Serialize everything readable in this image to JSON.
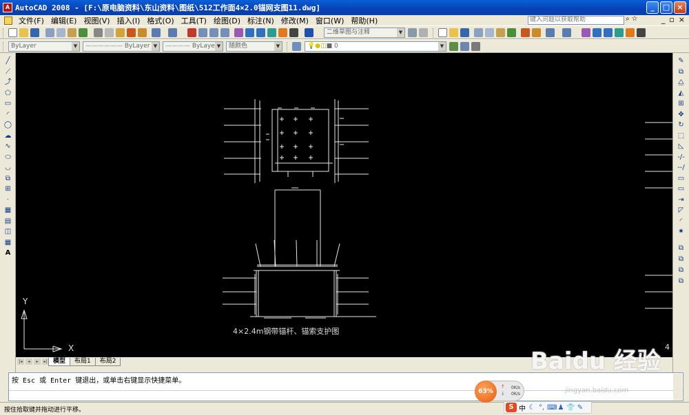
{
  "window": {
    "title": "AutoCAD 2008 - [F:\\原电脑资料\\东山资料\\图纸\\512工作面4×2.0锚网支图11.dwg]",
    "app_icon_text": "A"
  },
  "menu": {
    "items": [
      "文件(F)",
      "编辑(E)",
      "视图(V)",
      "插入(I)",
      "格式(O)",
      "工具(T)",
      "绘图(D)",
      "标注(N)",
      "修改(M)",
      "窗口(W)",
      "帮助(H)"
    ],
    "help_placeholder": "键入问题以获取帮助"
  },
  "toolbar": {
    "workspace_combo": "二维草图与注释",
    "layer_color_combo": "ByLayer",
    "linetype_combo": "ByLayer",
    "lineweight_combo": "ByLayer",
    "plotstyle_combo": "随颜色",
    "layer_name": "0"
  },
  "drawing": {
    "caption": "4×2.4m钢带锚杆、锚索支护图",
    "corner_number": "4",
    "ucs_x": "X",
    "ucs_y": "Y"
  },
  "layout_tabs": [
    "模型",
    "布局1",
    "布局2"
  ],
  "command": {
    "text": "按 Esc 或 Enter 键退出，或单击右键显示快捷菜单。"
  },
  "status": {
    "text": "按住拾取键并拖动进行平移。"
  },
  "speed_widget": {
    "percent": "63%",
    "upload": "0K/s",
    "download": "0K/s"
  },
  "ime": {
    "logo": "S",
    "mode": "中"
  },
  "watermark": {
    "brand": "Baidu 经验",
    "url": "jingyan.baidu.com"
  },
  "colors": {
    "canvas": "#000000",
    "titlebar": "#0a4fc6",
    "chrome": "#ece9d8"
  }
}
